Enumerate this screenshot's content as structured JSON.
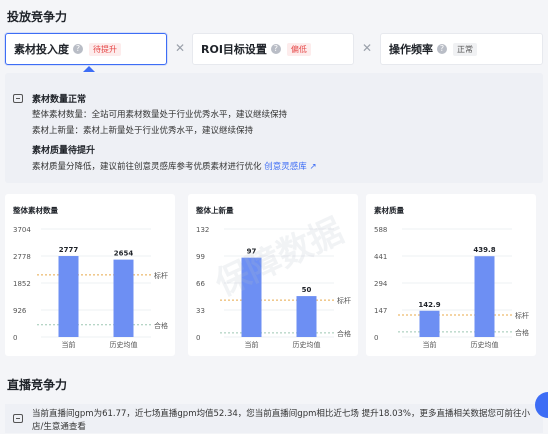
{
  "section1": {
    "title": "投放竞争力"
  },
  "tabs": [
    {
      "label": "素材投入度",
      "tag": "待提升",
      "tag_color": "red"
    },
    {
      "label": "ROI目标设置",
      "tag": "偏低",
      "tag_color": "red"
    },
    {
      "label": "操作频率",
      "tag": "正常",
      "tag_color": "gray"
    }
  ],
  "info": {
    "heading1": "素材数量正常",
    "line1": "整体素材数量：全站可用素材数量处于行业优秀水平，建议继续保持",
    "line2": "素材上新量：素材上新量处于行业优秀水平，建议继续保持",
    "heading2": "素材质量待提升",
    "line3": "素材质量分降低，建议前往创意灵感库参考优质素材进行优化",
    "link": "创意灵感库"
  },
  "colors": {
    "accent": "#3d6df5",
    "bar": "#6d8ff3",
    "benchmark": "#e8a94a",
    "pass": "#9ec7b4"
  },
  "chart_data": [
    {
      "type": "bar",
      "title": "整体素材数量",
      "categories": [
        "当前",
        "历史均值"
      ],
      "values": [
        2777,
        2654
      ],
      "yticks": [
        0,
        926,
        1852,
        2778,
        3704
      ],
      "ylim": [
        0,
        3704
      ],
      "reference_lines": [
        {
          "name": "标杆",
          "value": 2130
        },
        {
          "name": "合格",
          "value": 420
        }
      ]
    },
    {
      "type": "bar",
      "title": "整体上新量",
      "categories": [
        "当前",
        "历史均值"
      ],
      "values": [
        97,
        50
      ],
      "yticks": [
        0,
        33,
        66,
        99,
        132
      ],
      "ylim": [
        0,
        132
      ],
      "reference_lines": [
        {
          "name": "标杆",
          "value": 45
        },
        {
          "name": "合格",
          "value": 5
        }
      ]
    },
    {
      "type": "bar",
      "title": "素材质量",
      "categories": [
        "当前",
        "历史均值"
      ],
      "values": [
        142.9,
        439.8
      ],
      "yticks": [
        0,
        147,
        294,
        441,
        588
      ],
      "ylim": [
        0,
        588
      ],
      "reference_lines": [
        {
          "name": "标杆",
          "value": 120
        },
        {
          "name": "合格",
          "value": 28
        }
      ]
    }
  ],
  "section2": {
    "title": "直播竞争力"
  },
  "live": {
    "text": "当前直播间gpm为61.77，近七场直播gpm均值52.34，您当前直播间gpm相比近七场 提升18.03%，更多直播相关数据您可前往小店/生意通查看"
  }
}
